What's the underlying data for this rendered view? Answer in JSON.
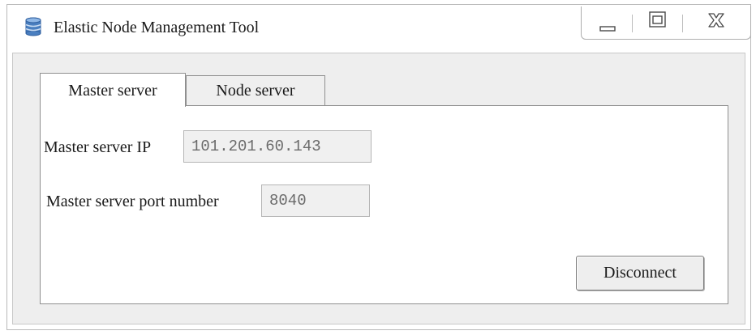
{
  "window": {
    "title": "Elastic Node Management Tool",
    "app_icon": "database-icon",
    "controls": {
      "minimize_icon": "minimize-icon",
      "maximize_icon": "maximize-icon",
      "close_icon": "close-icon"
    }
  },
  "tabs": [
    {
      "label": "Master server",
      "selected": true
    },
    {
      "label": "Node server",
      "selected": false
    }
  ],
  "master_tab": {
    "ip_label": "Master server IP",
    "ip_value": "101.201.60.143",
    "port_label": "Master server port number",
    "port_value": "8040",
    "disconnect_label": "Disconnect"
  },
  "colors": {
    "icon_blue": "#4a7fc0",
    "panel_bg": "#eeeeee"
  }
}
